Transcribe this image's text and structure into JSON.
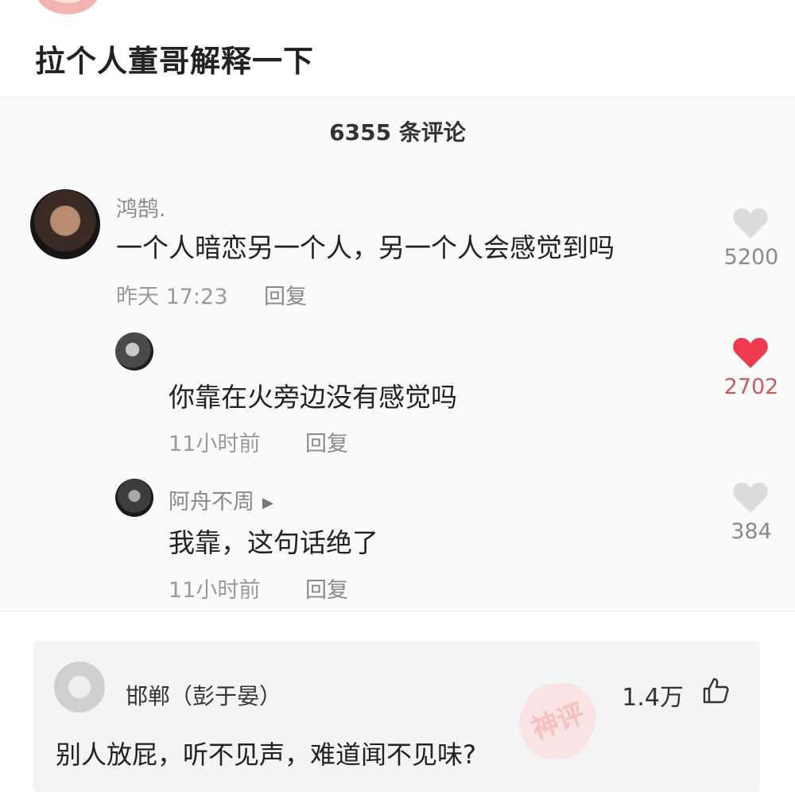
{
  "post": {
    "title": "拉个人董哥解释一下"
  },
  "comments_panel": {
    "count_label": "6355 条评论",
    "comments": [
      {
        "username": "鸿鹄.",
        "text": "一个人暗恋另一个人，另一个人会感觉到吗",
        "time": "昨天 17:23",
        "reply_label": "回复",
        "likes": "5200",
        "liked": false
      },
      {
        "username": "",
        "text": "你靠在火旁边没有感觉吗",
        "time": "11小时前",
        "reply_label": "回复",
        "likes": "2702",
        "liked": true
      },
      {
        "username": "阿舟不周",
        "text": "我靠，这句话绝了",
        "time": "11小时前",
        "reply_label": "回复",
        "likes": "384",
        "liked": false
      }
    ]
  },
  "featured_card": {
    "username": "邯郸（彭于晏）",
    "text": "别人放屁，听不见声，难道闻不见味?",
    "likes": "1.4万",
    "stamp_text": "神评"
  },
  "colors": {
    "liked_heart": "#ee3a4c",
    "unliked_heart": "#dcdcdc",
    "stamp": "#f7c1c1"
  },
  "icons": [
    "heart-icon",
    "play-icon",
    "thumbs-up-icon"
  ]
}
